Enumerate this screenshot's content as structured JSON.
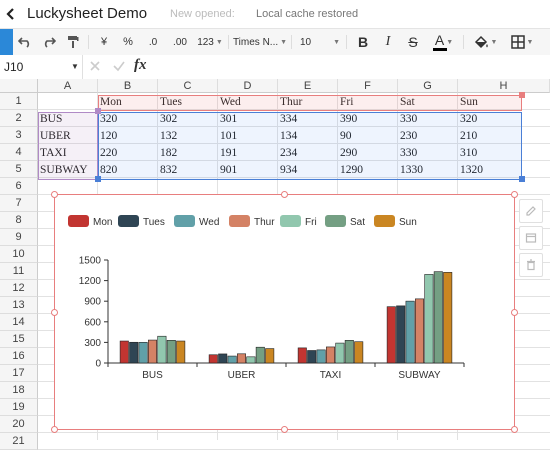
{
  "app": {
    "title": "Luckysheet Demo",
    "status_label": "New opened:",
    "status_value": "Local cache restored"
  },
  "toolbar": {
    "currency_label": "¥",
    "percent_label": "%",
    "decrease_decimal_label": ".0",
    "increase_decimal_label": ".00",
    "number_format_label": "123",
    "font_name": "Times N...",
    "font_size": "10",
    "bold_label": "B",
    "italic_label": "I",
    "strike_label": "S",
    "text_color_label": "A",
    "accent_color": "#2b88d8",
    "text_color_bar": "#000000"
  },
  "formula_bar": {
    "cell_ref": "J10",
    "fx_label": "fx"
  },
  "grid": {
    "columns": [
      "A",
      "B",
      "C",
      "D",
      "E",
      "F",
      "G",
      "H"
    ],
    "rows": [
      "1",
      "2",
      "3",
      "4",
      "5",
      "6",
      "7",
      "8",
      "9",
      "10",
      "11",
      "12",
      "13",
      "14",
      "15",
      "16",
      "17",
      "18",
      "19",
      "20",
      "21"
    ],
    "header_row": [
      "",
      "Mon",
      "Tues",
      "Wed",
      "Thur",
      "Fri",
      "Sat",
      "Sun"
    ],
    "data_rows": [
      [
        "BUS",
        "320",
        "302",
        "301",
        "334",
        "390",
        "330",
        "320"
      ],
      [
        "UBER",
        "120",
        "132",
        "101",
        "134",
        "90",
        "230",
        "210"
      ],
      [
        "TAXI",
        "220",
        "182",
        "191",
        "234",
        "290",
        "330",
        "310"
      ],
      [
        "SUBWAY",
        "820",
        "832",
        "901",
        "934",
        "1290",
        "1330",
        "1320"
      ]
    ]
  },
  "chart_data": {
    "type": "bar",
    "title": "",
    "categories": [
      "BUS",
      "UBER",
      "TAXI",
      "SUBWAY"
    ],
    "series": [
      {
        "name": "Mon",
        "color": "#c23531",
        "values": [
          320,
          120,
          220,
          820
        ]
      },
      {
        "name": "Tues",
        "color": "#2f4554",
        "values": [
          302,
          132,
          182,
          832
        ]
      },
      {
        "name": "Wed",
        "color": "#61a0a8",
        "values": [
          301,
          101,
          191,
          901
        ]
      },
      {
        "name": "Thur",
        "color": "#d48265",
        "values": [
          334,
          134,
          234,
          934
        ]
      },
      {
        "name": "Fri",
        "color": "#91c7ae",
        "values": [
          390,
          90,
          290,
          1290
        ]
      },
      {
        "name": "Sat",
        "color": "#749f83",
        "values": [
          330,
          230,
          330,
          1330
        ]
      },
      {
        "name": "Sun",
        "color": "#ca8622",
        "values": [
          320,
          210,
          310,
          1320
        ]
      }
    ],
    "ylim": [
      0,
      1500
    ],
    "yticks": [
      "0",
      "300",
      "600",
      "900",
      "1200",
      "1500"
    ],
    "legend_position": "top-left",
    "grid": false
  }
}
